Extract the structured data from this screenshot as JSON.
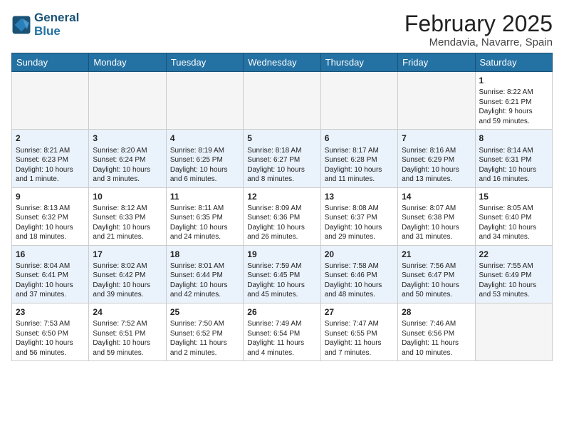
{
  "logo": {
    "line1": "General",
    "line2": "Blue"
  },
  "title": "February 2025",
  "location": "Mendavia, Navarre, Spain",
  "weekdays": [
    "Sunday",
    "Monday",
    "Tuesday",
    "Wednesday",
    "Thursday",
    "Friday",
    "Saturday"
  ],
  "weeks": [
    {
      "alt": false,
      "days": [
        {
          "num": "",
          "info": ""
        },
        {
          "num": "",
          "info": ""
        },
        {
          "num": "",
          "info": ""
        },
        {
          "num": "",
          "info": ""
        },
        {
          "num": "",
          "info": ""
        },
        {
          "num": "",
          "info": ""
        },
        {
          "num": "1",
          "info": "Sunrise: 8:22 AM\nSunset: 6:21 PM\nDaylight: 9 hours\nand 59 minutes."
        }
      ]
    },
    {
      "alt": true,
      "days": [
        {
          "num": "2",
          "info": "Sunrise: 8:21 AM\nSunset: 6:23 PM\nDaylight: 10 hours\nand 1 minute."
        },
        {
          "num": "3",
          "info": "Sunrise: 8:20 AM\nSunset: 6:24 PM\nDaylight: 10 hours\nand 3 minutes."
        },
        {
          "num": "4",
          "info": "Sunrise: 8:19 AM\nSunset: 6:25 PM\nDaylight: 10 hours\nand 6 minutes."
        },
        {
          "num": "5",
          "info": "Sunrise: 8:18 AM\nSunset: 6:27 PM\nDaylight: 10 hours\nand 8 minutes."
        },
        {
          "num": "6",
          "info": "Sunrise: 8:17 AM\nSunset: 6:28 PM\nDaylight: 10 hours\nand 11 minutes."
        },
        {
          "num": "7",
          "info": "Sunrise: 8:16 AM\nSunset: 6:29 PM\nDaylight: 10 hours\nand 13 minutes."
        },
        {
          "num": "8",
          "info": "Sunrise: 8:14 AM\nSunset: 6:31 PM\nDaylight: 10 hours\nand 16 minutes."
        }
      ]
    },
    {
      "alt": false,
      "days": [
        {
          "num": "9",
          "info": "Sunrise: 8:13 AM\nSunset: 6:32 PM\nDaylight: 10 hours\nand 18 minutes."
        },
        {
          "num": "10",
          "info": "Sunrise: 8:12 AM\nSunset: 6:33 PM\nDaylight: 10 hours\nand 21 minutes."
        },
        {
          "num": "11",
          "info": "Sunrise: 8:11 AM\nSunset: 6:35 PM\nDaylight: 10 hours\nand 24 minutes."
        },
        {
          "num": "12",
          "info": "Sunrise: 8:09 AM\nSunset: 6:36 PM\nDaylight: 10 hours\nand 26 minutes."
        },
        {
          "num": "13",
          "info": "Sunrise: 8:08 AM\nSunset: 6:37 PM\nDaylight: 10 hours\nand 29 minutes."
        },
        {
          "num": "14",
          "info": "Sunrise: 8:07 AM\nSunset: 6:38 PM\nDaylight: 10 hours\nand 31 minutes."
        },
        {
          "num": "15",
          "info": "Sunrise: 8:05 AM\nSunset: 6:40 PM\nDaylight: 10 hours\nand 34 minutes."
        }
      ]
    },
    {
      "alt": true,
      "days": [
        {
          "num": "16",
          "info": "Sunrise: 8:04 AM\nSunset: 6:41 PM\nDaylight: 10 hours\nand 37 minutes."
        },
        {
          "num": "17",
          "info": "Sunrise: 8:02 AM\nSunset: 6:42 PM\nDaylight: 10 hours\nand 39 minutes."
        },
        {
          "num": "18",
          "info": "Sunrise: 8:01 AM\nSunset: 6:44 PM\nDaylight: 10 hours\nand 42 minutes."
        },
        {
          "num": "19",
          "info": "Sunrise: 7:59 AM\nSunset: 6:45 PM\nDaylight: 10 hours\nand 45 minutes."
        },
        {
          "num": "20",
          "info": "Sunrise: 7:58 AM\nSunset: 6:46 PM\nDaylight: 10 hours\nand 48 minutes."
        },
        {
          "num": "21",
          "info": "Sunrise: 7:56 AM\nSunset: 6:47 PM\nDaylight: 10 hours\nand 50 minutes."
        },
        {
          "num": "22",
          "info": "Sunrise: 7:55 AM\nSunset: 6:49 PM\nDaylight: 10 hours\nand 53 minutes."
        }
      ]
    },
    {
      "alt": false,
      "days": [
        {
          "num": "23",
          "info": "Sunrise: 7:53 AM\nSunset: 6:50 PM\nDaylight: 10 hours\nand 56 minutes."
        },
        {
          "num": "24",
          "info": "Sunrise: 7:52 AM\nSunset: 6:51 PM\nDaylight: 10 hours\nand 59 minutes."
        },
        {
          "num": "25",
          "info": "Sunrise: 7:50 AM\nSunset: 6:52 PM\nDaylight: 11 hours\nand 2 minutes."
        },
        {
          "num": "26",
          "info": "Sunrise: 7:49 AM\nSunset: 6:54 PM\nDaylight: 11 hours\nand 4 minutes."
        },
        {
          "num": "27",
          "info": "Sunrise: 7:47 AM\nSunset: 6:55 PM\nDaylight: 11 hours\nand 7 minutes."
        },
        {
          "num": "28",
          "info": "Sunrise: 7:46 AM\nSunset: 6:56 PM\nDaylight: 11 hours\nand 10 minutes."
        },
        {
          "num": "",
          "info": ""
        }
      ]
    }
  ]
}
